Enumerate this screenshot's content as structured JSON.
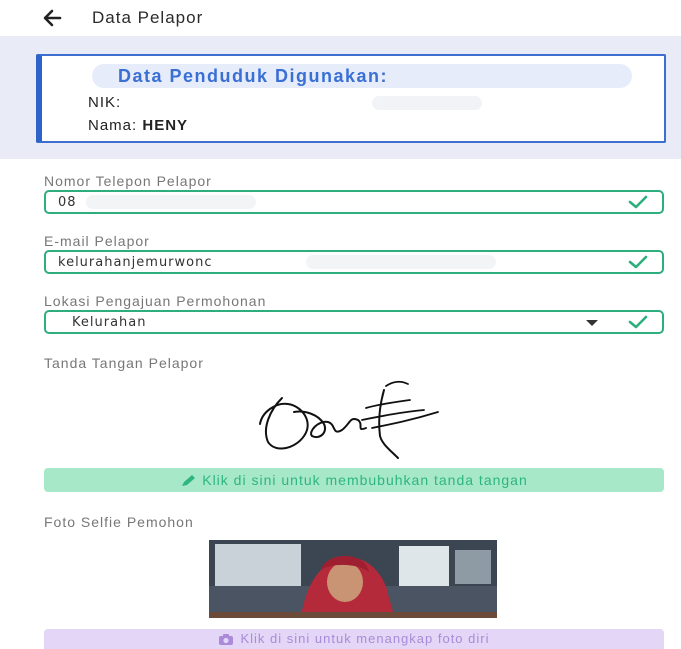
{
  "header": {
    "title": "Data Pelapor",
    "back_icon": "arrow-left-icon"
  },
  "resident_card": {
    "heading": "Data Penduduk Digunakan:",
    "nik_label": "NIK:",
    "name_label": "Nama:",
    "name_value": "HENY"
  },
  "phone": {
    "label": "Nomor Telepon Pelapor",
    "value": "08"
  },
  "email": {
    "label": "E-mail Pelapor",
    "value": "kelurahanjemurwonc"
  },
  "location": {
    "label": "Lokasi Pengajuan Permohonan",
    "value": "Kelurahan"
  },
  "signature": {
    "label": "Tanda Tangan Pelapor",
    "button_label": "Klik di sini untuk membubuhkan tanda tangan",
    "button_icon": "pencil-icon"
  },
  "selfie": {
    "label": "Foto Selfie Pemohon",
    "button_label": "Klik di sini untuk menangkap foto diri",
    "button_icon": "camera-icon"
  },
  "colors": {
    "accent_blue": "#2f63c9",
    "success_green": "#2fae7d",
    "sign_button_bg": "#a6e8c8",
    "photo_button_bg": "#e3d6f6"
  }
}
